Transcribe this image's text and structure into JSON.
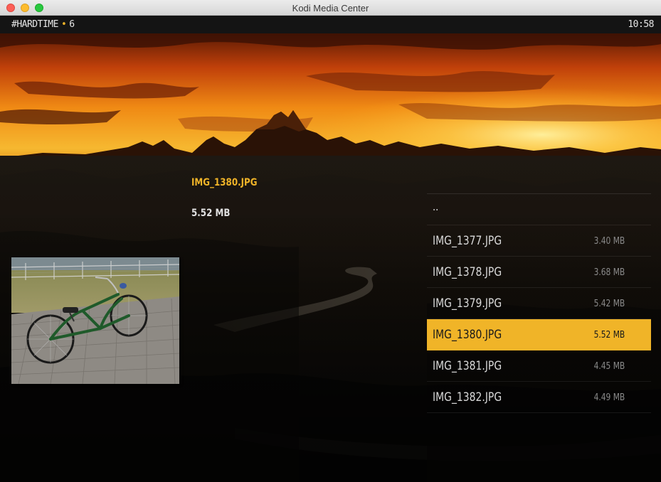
{
  "window": {
    "title": "Kodi Media Center"
  },
  "topbar": {
    "breadcrumb": "#HARDTIME",
    "separator": "•",
    "count": "6",
    "clock": "10:58"
  },
  "info": {
    "filename": "IMG_1380.JPG",
    "filesize": "5.52 MB"
  },
  "filelist": {
    "parent_label": "..",
    "items": [
      {
        "name": "IMG_1377.JPG",
        "size": "3.40 MB"
      },
      {
        "name": "IMG_1378.JPG",
        "size": "3.68 MB"
      },
      {
        "name": "IMG_1379.JPG",
        "size": "5.42 MB"
      },
      {
        "name": "IMG_1380.JPG",
        "size": "5.52 MB"
      },
      {
        "name": "IMG_1381.JPG",
        "size": "4.45 MB"
      },
      {
        "name": "IMG_1382.JPG",
        "size": "4.49 MB"
      }
    ],
    "selected_index": 3
  },
  "colors": {
    "accent": "#f0b428",
    "title_bar": "#e3e3e3",
    "top_bar": "#141414"
  }
}
